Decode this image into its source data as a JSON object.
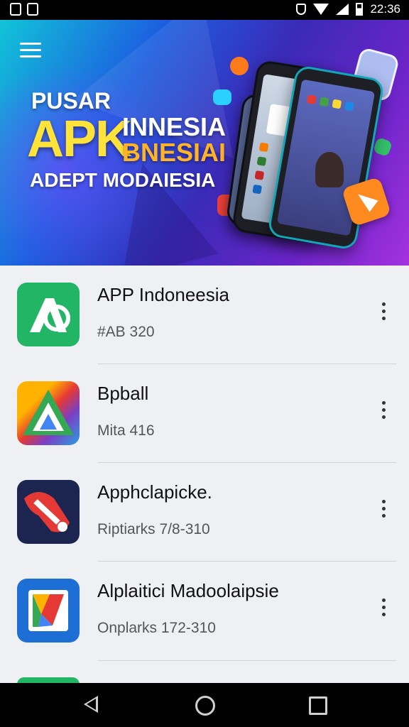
{
  "status_bar": {
    "time": "22:36"
  },
  "banner": {
    "line1": "PUSAR",
    "big": "APK",
    "sub1": "INNESIA",
    "sub2": "BNESIAI",
    "line3": "ADEPT MODAIESIA"
  },
  "apps": [
    {
      "title": "APP Indoneesia",
      "meta": "#AB 320",
      "icon": "app-logo-icon"
    },
    {
      "title": "Bpball",
      "meta": "Mita 416",
      "icon": "triangle-logo-icon"
    },
    {
      "title": "Apphclapicke.",
      "meta": "Riptiarks 7/8-310",
      "icon": "red-shape-logo-icon"
    },
    {
      "title": "Alplaitici Madoolaipsie",
      "meta": "Onplarks 172-310",
      "icon": "folded-logo-icon"
    }
  ],
  "colors": {
    "accent_green": "#22b565",
    "banner_purple": "#6a24c8",
    "banner_yellow": "#ffe23a"
  }
}
